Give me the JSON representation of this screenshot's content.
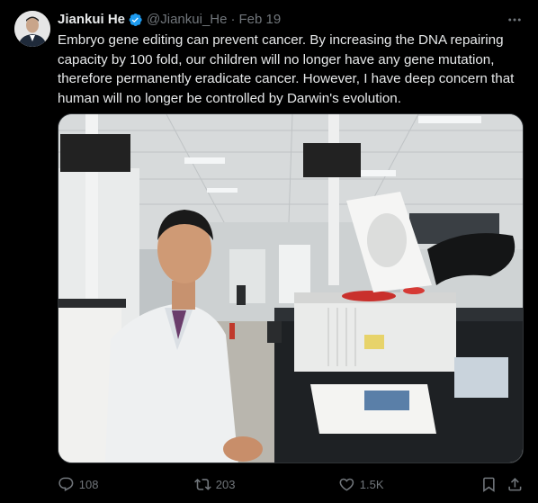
{
  "author": {
    "name": "Jiankui He",
    "handle": "@Jiankui_He",
    "separator": "·",
    "date": "Feb 19"
  },
  "tweet": {
    "text": "Embryo gene editing can prevent cancer. By increasing the DNA repairing capacity by 100 fold, our children will no longer have any gene mutation, therefore permanently eradicate cancer. However, I have deep concern that human will no longer be controlled by Darwin's evolution."
  },
  "actions": {
    "replies": "108",
    "retweets": "203",
    "likes": "1.5K"
  },
  "colors": {
    "background": "#000000",
    "text": "#e7e9ea",
    "muted": "#71767b",
    "verified": "#1d9bf0"
  }
}
